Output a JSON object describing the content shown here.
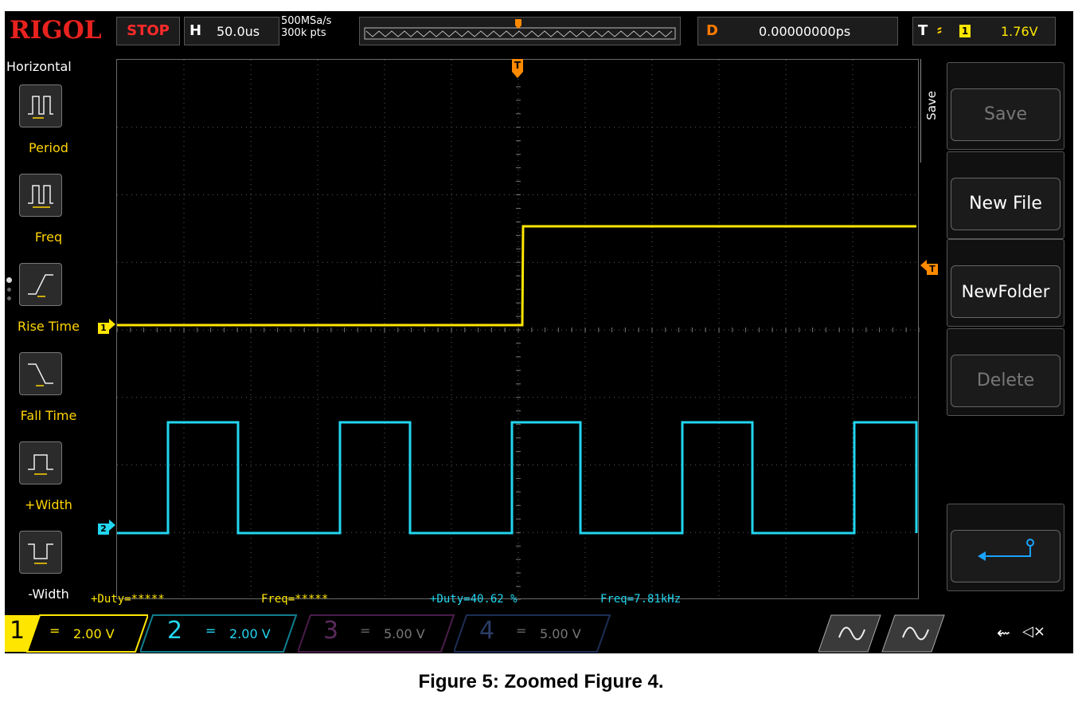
{
  "brand": "RIGOL",
  "run_state": "STOP",
  "timebase": {
    "label": "H",
    "value": "50.0us"
  },
  "acquisition": {
    "sample_rate": "500MSa/s",
    "memory_depth": "300k pts"
  },
  "delay": {
    "label": "D",
    "value": "0.00000000ps"
  },
  "trigger": {
    "label": "T",
    "source": "1",
    "level": "1.76V"
  },
  "left_menu": {
    "title": "Horizontal",
    "items": [
      {
        "label": "Period"
      },
      {
        "label": "Freq"
      },
      {
        "label": "Rise Time"
      },
      {
        "label": "Fall Time"
      },
      {
        "label": "+Width"
      },
      {
        "label": "-Width"
      }
    ]
  },
  "markers": {
    "trigger": "T",
    "ch1": "1",
    "ch2": "2",
    "trig_level": "T"
  },
  "measurements": [
    {
      "text": "+Duty=*****"
    },
    {
      "text": "Freq=*****"
    },
    {
      "text": "+Duty=40.62 %"
    },
    {
      "text": "Freq=7.81kHz"
    }
  ],
  "right_menu": {
    "tab": "Save",
    "items": [
      {
        "label": "Save",
        "enabled": false
      },
      {
        "label": "New File",
        "enabled": true
      },
      {
        "label": "NewFolder",
        "enabled": true
      },
      {
        "label": "Delete",
        "enabled": false
      }
    ]
  },
  "channels": [
    {
      "num": "1",
      "coupling": "=",
      "scale": "2.00 V",
      "color": "#ffe600"
    },
    {
      "num": "2",
      "coupling": "=",
      "scale": "2.00 V",
      "color": "#22d6f0"
    },
    {
      "num": "3",
      "coupling": "=",
      "scale": "5.00 V",
      "color": "#d24ed2"
    },
    {
      "num": "4",
      "coupling": "=",
      "scale": "5.00 V",
      "color": "#2f6fd6"
    }
  ],
  "caption": "Figure 5: Zoomed Figure 4.",
  "colors": {
    "ch1": "#ffe600",
    "ch2": "#22d6f0",
    "trigger": "#ff8a00",
    "stop": "#ff2a2a",
    "brand": "#e8221e"
  }
}
